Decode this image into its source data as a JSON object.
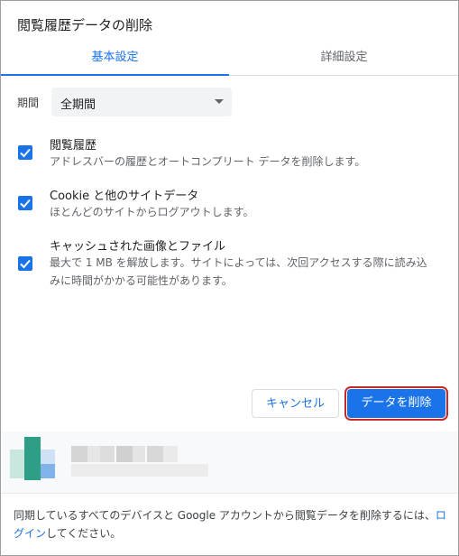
{
  "dialog": {
    "title": "閲覧履歴データの削除"
  },
  "tabs": [
    {
      "label": "基本設定"
    },
    {
      "label": "詳細設定"
    }
  ],
  "period": {
    "label": "期間",
    "value": "全期間"
  },
  "items": [
    {
      "title": "閲覧履歴",
      "desc": "アドレスバーの履歴とオートコンプリート データを削除します。"
    },
    {
      "title": "Cookie と他のサイトデータ",
      "desc": "ほとんどのサイトからログアウトします。"
    },
    {
      "title": "キャッシュされた画像とファイル",
      "desc": "最大で 1 MB を解放します。サイトによっては、次回アクセスする際に読み込みに時間がかかる可能性があります。"
    }
  ],
  "buttons": {
    "cancel": "キャンセル",
    "delete": "データを削除"
  },
  "footer": {
    "text_before": "同期しているすべてのデバイスと Google アカウントから閲覧データを削除するには、",
    "link": "ログイン",
    "text_after": "してください。"
  },
  "colors": {
    "accent": "#1a73e8",
    "highlight": "#c62828"
  }
}
